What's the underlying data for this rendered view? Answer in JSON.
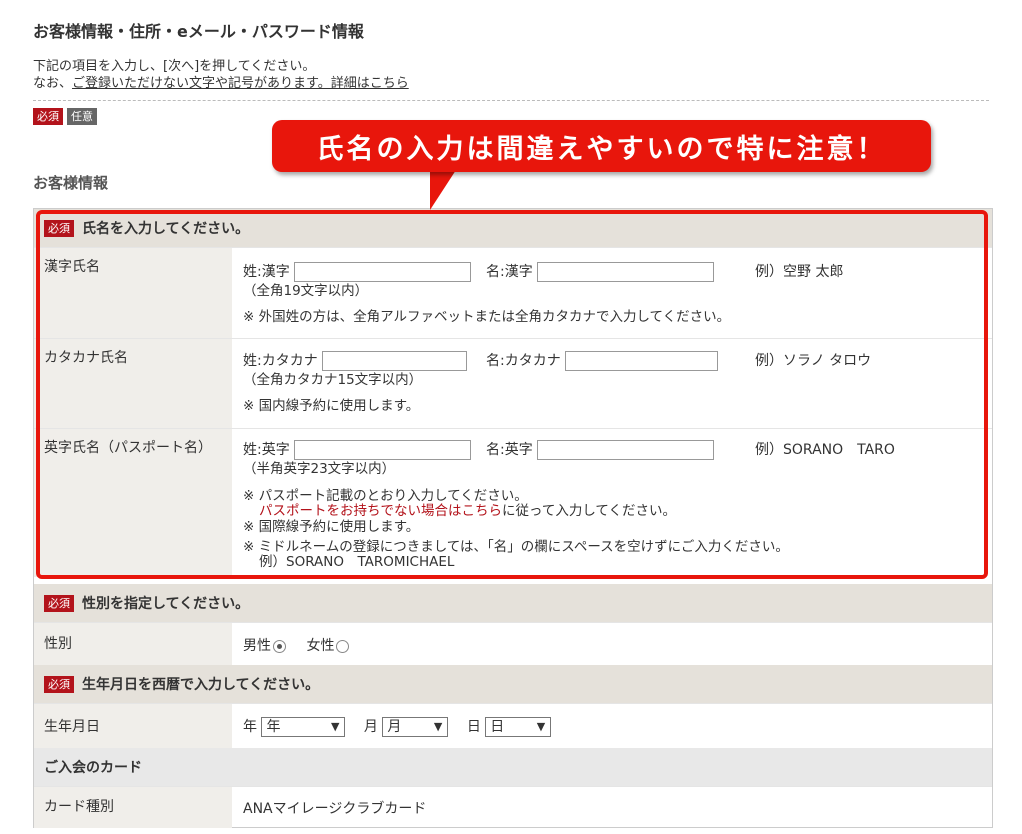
{
  "page_title": "お客様情報・住所・eメール・パスワード情報",
  "intro": {
    "line1": "下記の項目を入力し、[次へ]を押してください。",
    "line2_prefix": "なお、",
    "line2_link": "ご登録いただけない文字や記号があります。詳細はこちら"
  },
  "legend": {
    "required": "必須",
    "optional": "任意"
  },
  "callout": "氏名の入力は間違えやすいので特に注意！",
  "section_heading": "お客様情報",
  "colors": {
    "required_badge": "#b3131b",
    "callout": "#e8160c",
    "head_bg": "#e5e1da"
  },
  "name_group": {
    "badge": "必須",
    "heading": "氏名を入力してください。",
    "kanji": {
      "label": "漢字氏名",
      "sei_label": "姓:漢字",
      "mei_label": "名:漢字",
      "example": "例）空野 太郎",
      "limit": "（全角19文字以内）",
      "note": "※ 外国姓の方は、全角アルファベットまたは全角カタカナで入力してください。"
    },
    "kana": {
      "label": "カタカナ氏名",
      "sei_label": "姓:カタカナ",
      "mei_label": "名:カタカナ",
      "example": "例）ソラノ タロウ",
      "limit": "（全角カタカナ15文字以内）",
      "note": "※ 国内線予約に使用します。"
    },
    "roman": {
      "label": "英字氏名（パスポート名）",
      "sei_label": "姓:英字",
      "mei_label": "名:英字",
      "example": "例）SORANO　TARO",
      "limit": "（半角英字23文字以内）",
      "note1": "※ パスポート記載のとおり入力してください。",
      "note1_link": "パスポートをお持ちでない場合はこちら",
      "note1_suffix": "に従って入力してください。",
      "note2": "※ 国際線予約に使用します。",
      "note3": "※ ミドルネームの登録につきましては、「名」の欄にスペースを空けずにご入力ください。",
      "note3_example": "例）SORANO　TAROMICHAEL"
    }
  },
  "gender_group": {
    "badge": "必須",
    "heading": "性別を指定してください。",
    "label": "性別",
    "male": "男性",
    "female": "女性",
    "selected": "男性"
  },
  "birth_group": {
    "badge": "必須",
    "heading": "生年月日を西暦で入力してください。",
    "label": "生年月日",
    "year_label": "年",
    "year_value": "年",
    "month_label": "月",
    "month_value": "月",
    "day_label": "日",
    "day_value": "日"
  },
  "card_group": {
    "heading": "ご入会のカード",
    "label": "カード種別",
    "value": "ANAマイレージクラブカード"
  }
}
